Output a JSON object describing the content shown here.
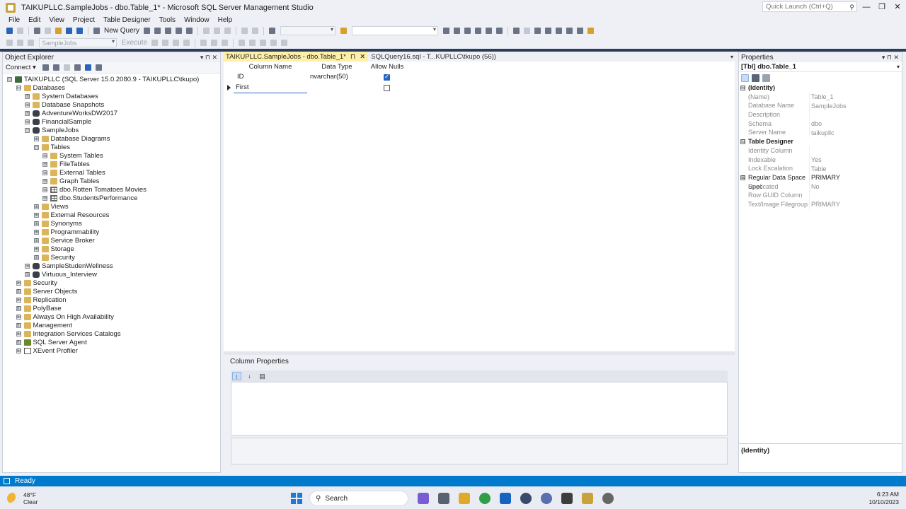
{
  "window": {
    "title": "TAIKUPLLC.SampleJobs - dbo.Table_1* - Microsoft SQL Server Management Studio",
    "quick_launch_placeholder": "Quick Launch (Ctrl+Q)",
    "minimize": "—",
    "restore": "❐",
    "close": "✕"
  },
  "menu": [
    "File",
    "Edit",
    "View",
    "Project",
    "Table Designer",
    "Tools",
    "Window",
    "Help"
  ],
  "toolbar": {
    "new_query": "New Query",
    "database_combo": "SampleJobs",
    "execute": "Execute"
  },
  "object_explorer": {
    "title": "Object Explorer",
    "connect": "Connect ▾",
    "pin": "▾ ⊓ ✕",
    "nodes": [
      {
        "label": "TAIKUPLLC (SQL Server 15.0.2080.9 - TAIKUPLLC\\tkupo)",
        "exp": "⊟",
        "icon": "server"
      },
      {
        "label": "Databases",
        "exp": "⊟",
        "icon": "folder"
      },
      {
        "label": "System Databases",
        "exp": "⊞",
        "icon": "folder"
      },
      {
        "label": "Database Snapshots",
        "exp": "⊞",
        "icon": "folder"
      },
      {
        "label": "AdventureWorksDW2017",
        "exp": "⊞",
        "icon": "db"
      },
      {
        "label": "FinancialSample",
        "exp": "⊞",
        "icon": "db"
      },
      {
        "label": "SampleJobs",
        "exp": "⊟",
        "icon": "db"
      },
      {
        "label": "Database Diagrams",
        "exp": "⊞",
        "icon": "folder"
      },
      {
        "label": "Tables",
        "exp": "⊟",
        "icon": "folder"
      },
      {
        "label": "System Tables",
        "exp": "⊞",
        "icon": "folder"
      },
      {
        "label": "FileTables",
        "exp": "⊞",
        "icon": "folder"
      },
      {
        "label": "External Tables",
        "exp": "⊞",
        "icon": "folder"
      },
      {
        "label": "Graph Tables",
        "exp": "⊞",
        "icon": "folder"
      },
      {
        "label": "dbo.Rotten Tomatoes Movies",
        "exp": "⊞",
        "icon": "table"
      },
      {
        "label": "dbo.StudentsPerformance",
        "exp": "⊞",
        "icon": "table"
      },
      {
        "label": "Views",
        "exp": "⊞",
        "icon": "folder"
      },
      {
        "label": "External Resources",
        "exp": "⊞",
        "icon": "folder"
      },
      {
        "label": "Synonyms",
        "exp": "⊞",
        "icon": "folder"
      },
      {
        "label": "Programmability",
        "exp": "⊞",
        "icon": "folder"
      },
      {
        "label": "Service Broker",
        "exp": "⊞",
        "icon": "folder"
      },
      {
        "label": "Storage",
        "exp": "⊞",
        "icon": "folder"
      },
      {
        "label": "Security",
        "exp": "⊞",
        "icon": "folder"
      },
      {
        "label": "SampleStudenWellness",
        "exp": "⊞",
        "icon": "db"
      },
      {
        "label": "Virtuous_Interview",
        "exp": "⊞",
        "icon": "db"
      },
      {
        "label": "Security",
        "exp": "⊞",
        "icon": "folder"
      },
      {
        "label": "Server Objects",
        "exp": "⊞",
        "icon": "folder"
      },
      {
        "label": "Replication",
        "exp": "⊞",
        "icon": "folder"
      },
      {
        "label": "PolyBase",
        "exp": "⊞",
        "icon": "folder"
      },
      {
        "label": "Always On High Availability",
        "exp": "⊞",
        "icon": "folder"
      },
      {
        "label": "Management",
        "exp": "⊞",
        "icon": "folder"
      },
      {
        "label": "Integration Services Catalogs",
        "exp": "⊞",
        "icon": "folder"
      },
      {
        "label": "SQL Server Agent",
        "exp": "⊞",
        "icon": "agent"
      },
      {
        "label": "XEvent Profiler",
        "exp": "⊞",
        "icon": "xevent"
      }
    ]
  },
  "tabs": [
    {
      "label": "TAIKUPLLC.SampleJobs - dbo.Table_1*",
      "pin": "⊓",
      "close": "✕"
    },
    {
      "label": "SQLQuery16.sql - T...KUPLLC\\tkupo (56))"
    }
  ],
  "tab_overflow": "▾",
  "designer": {
    "headers": [
      "Column Name",
      "Data Type",
      "Allow Nulls"
    ],
    "rows": [
      {
        "name": "ID",
        "type": "nvarchar(50)",
        "allow_nulls": true
      },
      {
        "name": "First",
        "type": "",
        "allow_nulls": false
      }
    ]
  },
  "column_properties": {
    "title": "Column Properties",
    "tools": [
      "⁝",
      "↓",
      "▤"
    ]
  },
  "properties": {
    "title": "Properties",
    "object": "[Tbl] dbo.Table_1",
    "rows": [
      {
        "key": "(Identity)",
        "value": "",
        "kind": "cat",
        "exp": "⊟"
      },
      {
        "key": "(Name)",
        "value": "Table_1"
      },
      {
        "key": "Database Name",
        "value": "SampleJobs"
      },
      {
        "key": "Description",
        "value": ""
      },
      {
        "key": "Schema",
        "value": "dbo"
      },
      {
        "key": "Server Name",
        "value": "taikupllc"
      },
      {
        "key": "Table Designer",
        "value": "",
        "kind": "cat",
        "exp": "⊟"
      },
      {
        "key": "Identity Column",
        "value": ""
      },
      {
        "key": "Indexable",
        "value": "Yes"
      },
      {
        "key": "Lock Escalation",
        "value": "Table"
      },
      {
        "key": "Regular Data Space Spec",
        "value": "PRIMARY",
        "kind": "bold",
        "exp": "⊞"
      },
      {
        "key": "Replicated",
        "value": "No"
      },
      {
        "key": "Row GUID Column",
        "value": ""
      },
      {
        "key": "Text/Image Filegroup",
        "value": "PRIMARY"
      }
    ],
    "description": "(Identity)"
  },
  "status": {
    "text": "Ready"
  },
  "taskbar": {
    "temperature": "48°F",
    "condition": "Clear",
    "search": "Search",
    "time": "6:23 AM",
    "date": "10/10/2023"
  },
  "colors": {
    "accent": "#007acc",
    "tab_active": "#fff0a8",
    "checkbox": "#2463c7"
  }
}
